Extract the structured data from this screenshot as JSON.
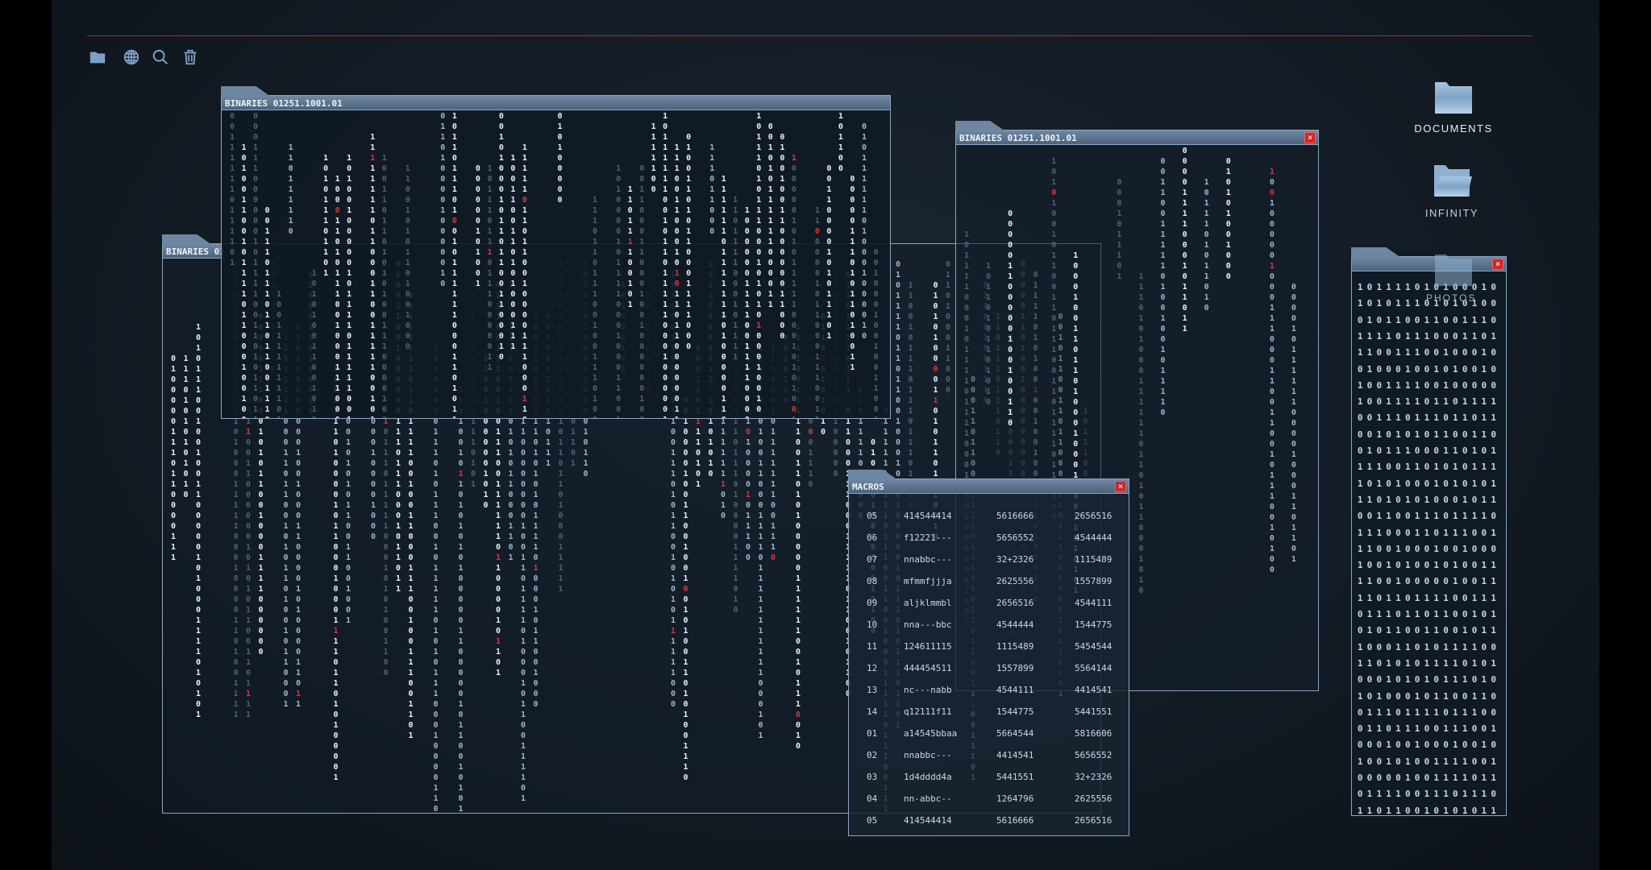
{
  "toolbar": {
    "icons": [
      "folder-icon",
      "globe-icon",
      "search-icon",
      "trash-icon"
    ]
  },
  "desktop": {
    "documents": "DOCUMENTS",
    "infinity": "INFINITY",
    "photos": "PHOTOS"
  },
  "windows": {
    "binaries_back": {
      "title": "BINARIES 01251.1001.01"
    },
    "binaries_top": {
      "title": "BINARIES 01251.1001.01"
    },
    "binaries_right": {
      "title": "BINARIES 01251.1001.01"
    },
    "macros": {
      "title": "MACROS",
      "rows": [
        [
          "05",
          "414544414",
          "5616666",
          "2656516"
        ],
        [
          "06",
          "f12221---",
          "5656552",
          "4544444"
        ],
        [
          "07",
          "nnabbc---",
          "32+2326",
          "1115489"
        ],
        [
          "08",
          "mfmmfjjja",
          "2625556",
          "1557899"
        ],
        [
          "09",
          "aljklmmbl",
          "2656516",
          "4544111"
        ],
        [
          "10",
          "nna---bbc",
          "4544444",
          "1544775"
        ],
        [
          "11",
          "124611115",
          "1115489",
          "5454544"
        ],
        [
          "12",
          "444454511",
          "1557899",
          "5564144"
        ],
        [
          "13",
          "nc---nabb",
          "4544111",
          "4414541"
        ],
        [
          "14",
          "q12111f11",
          "1544775",
          "5441551"
        ],
        [
          "01",
          "a14545bbaa",
          "5664544",
          "5816606"
        ],
        [
          "02",
          "nnabbc---",
          "4414541",
          "5656552"
        ],
        [
          "03",
          "1d4dddd4a",
          "5441551",
          "32+2326"
        ],
        [
          "04",
          "nn-abbc--",
          "1264796",
          "2625556"
        ],
        [
          "05",
          "414544414",
          "5616666",
          "2656516"
        ]
      ]
    },
    "photos": {
      "rows": [
        "101111010100010",
        "101011101010100",
        "010110011001110",
        "111101110001101",
        "110011100100010",
        "010001001010010",
        "100111100100000",
        "100111101101111",
        "001110111011011",
        "001010101100110",
        "010111000110101",
        "111001101010111",
        "101010001010101",
        "110101010001011",
        "001100111011110",
        "111000110111001",
        "110010001001000",
        "100101001010011",
        "110010000010011",
        "110110111100111",
        "011101101100101",
        "010110011001011",
        "100011010111100",
        "110101011110101",
        "000101010111010",
        "101000101100110",
        "011101111011100",
        "011011100111001",
        "000100100010010",
        "100101001111001",
        "000001001111011",
        "011110011101110",
        "110110010101011"
      ]
    }
  },
  "colors": {
    "accent_red": "#b3261e",
    "close_red": "#c92a2a",
    "frame": "#8aa6c2"
  }
}
